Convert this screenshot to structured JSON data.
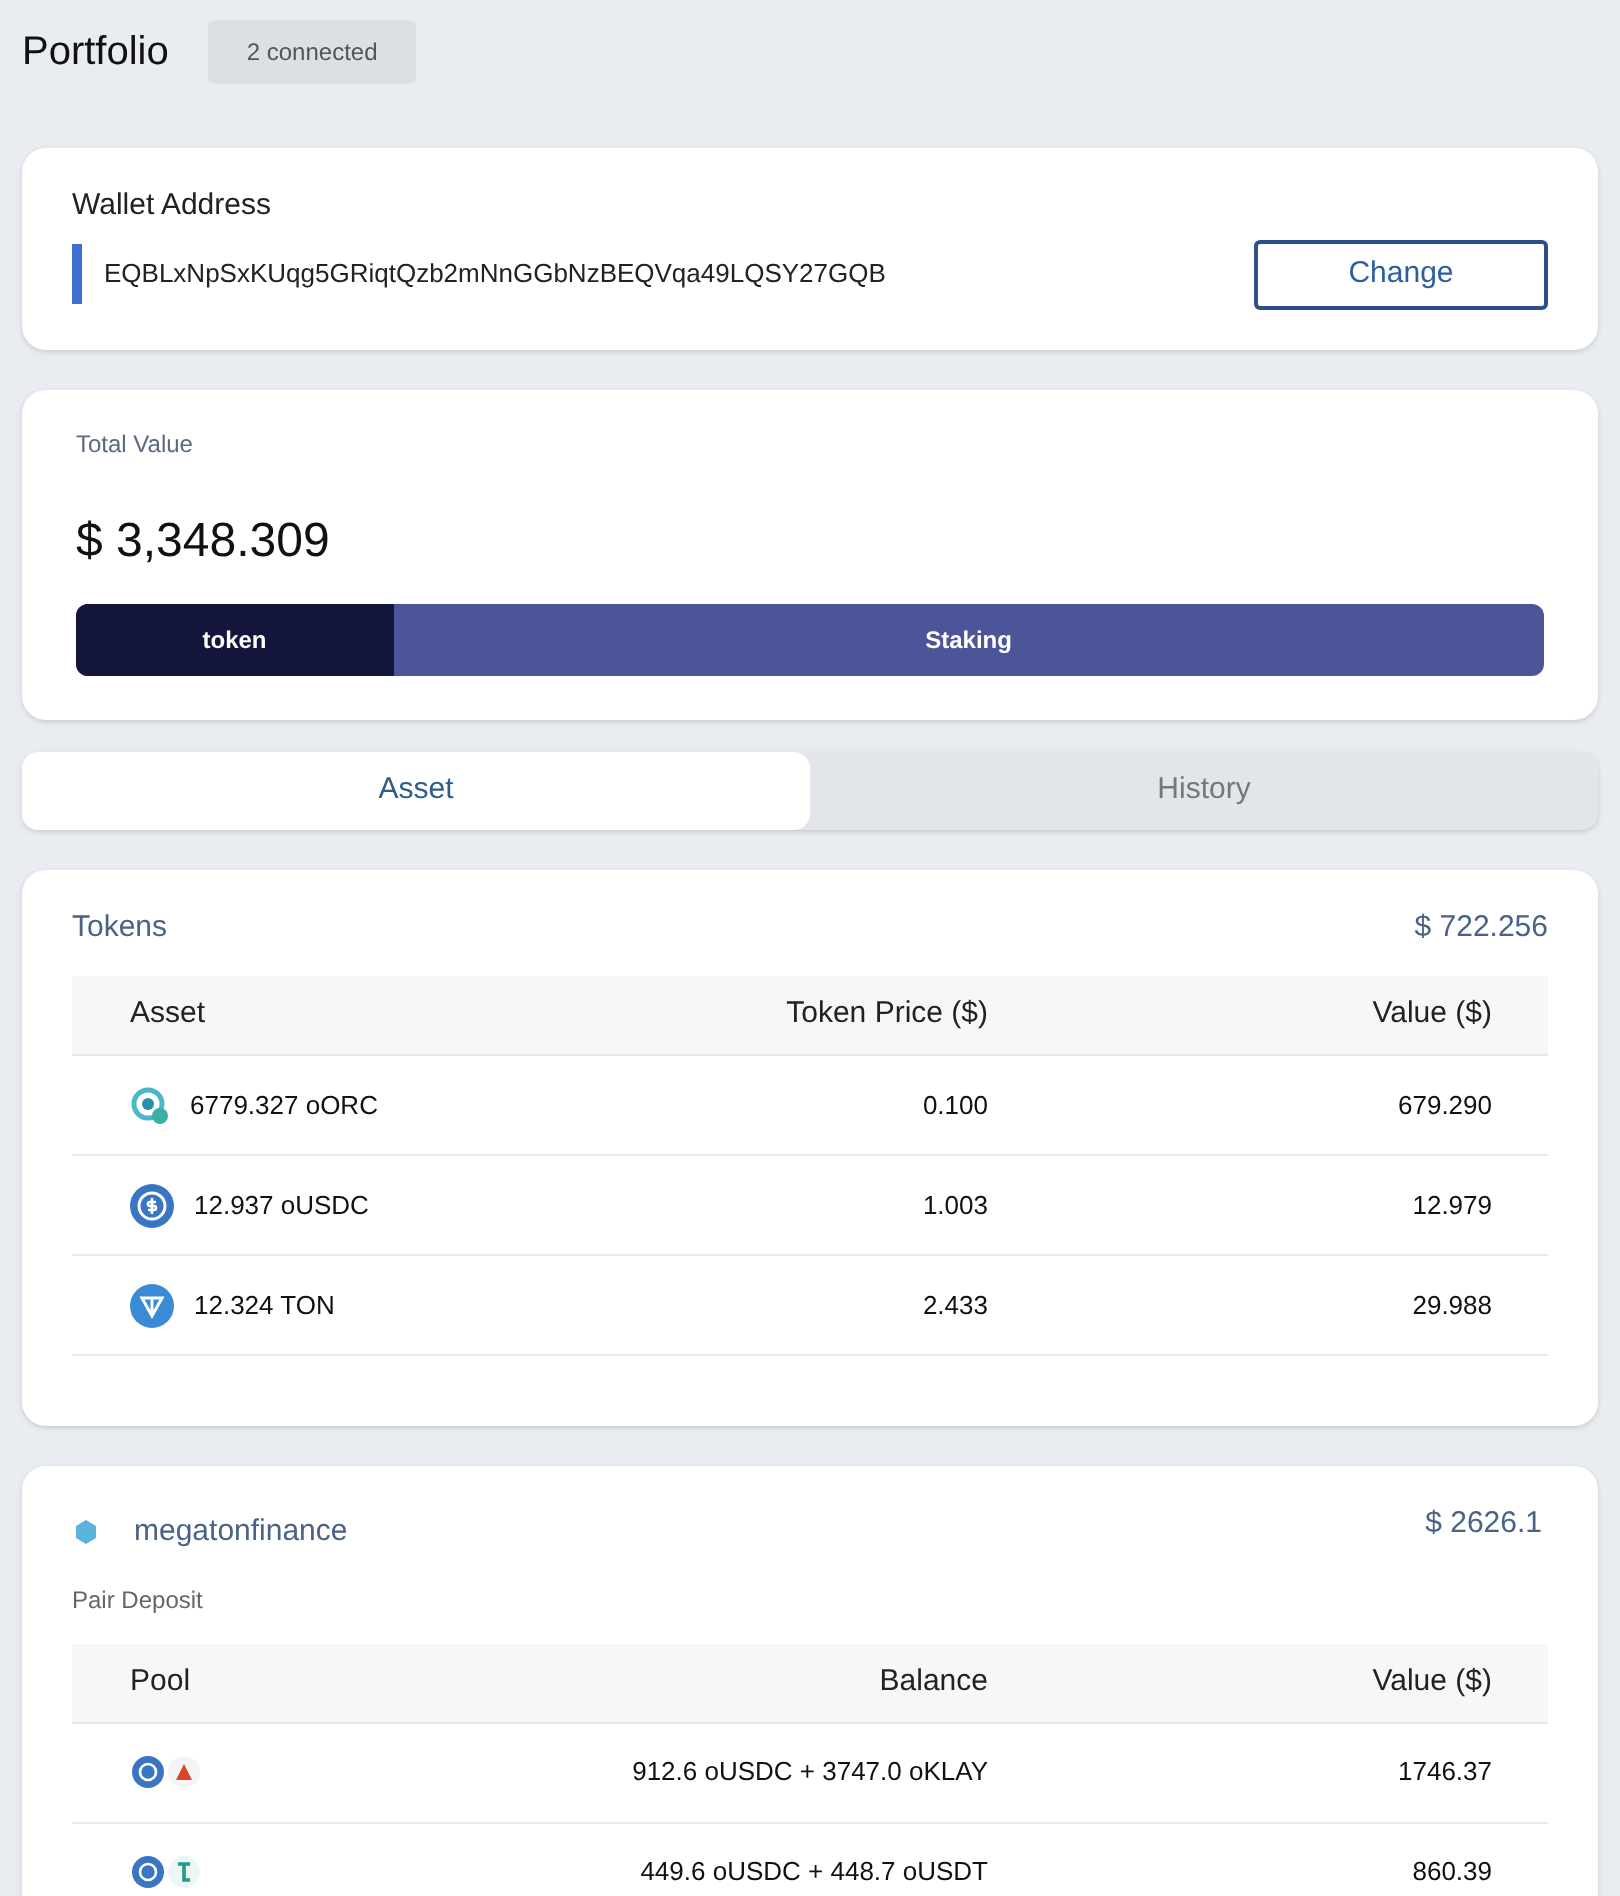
{
  "header": {
    "title": "Portfolio",
    "badge": "2 connected"
  },
  "wallet": {
    "label": "Wallet Address",
    "address": "EQBLxNpSxKUqg5GRiqtQzb2mNnGGbNzBEQVqa49LQSY27GQB",
    "button": "Change"
  },
  "total": {
    "label": "Total Value",
    "value": "$ 3,348.309",
    "distribution": {
      "level": 0.216,
      "fill_label": "token",
      "rest_label": "Staking"
    }
  },
  "tabs": [
    {
      "label": "Asset",
      "selected": true
    },
    {
      "label": "History",
      "selected": false
    }
  ],
  "tokens": {
    "title": "Tokens",
    "total": "$ 722.256",
    "columns": [
      "Asset",
      "Token Price ($)",
      "Value ($)"
    ],
    "rows": [
      {
        "asset": "6779.327 oORC",
        "price": "0.100",
        "value": "679.290"
      },
      {
        "asset": "12.937 oUSDC",
        "price": "1.003",
        "value": "12.979"
      },
      {
        "asset": "12.324 TON",
        "price": "2.433",
        "value": "29.988"
      }
    ]
  },
  "protocol": {
    "name": "megatonfinance",
    "total": "$ 2626.1",
    "section": "Pair Deposit",
    "columns": [
      "Pool",
      "Balance",
      "Value ($)"
    ],
    "rows": [
      {
        "balance": "912.6 oUSDC + 3747.0 oKLAY",
        "value": "1746.37"
      },
      {
        "balance": "449.6 oUSDC + 448.7 oUSDT",
        "value": "860.39"
      }
    ]
  }
}
